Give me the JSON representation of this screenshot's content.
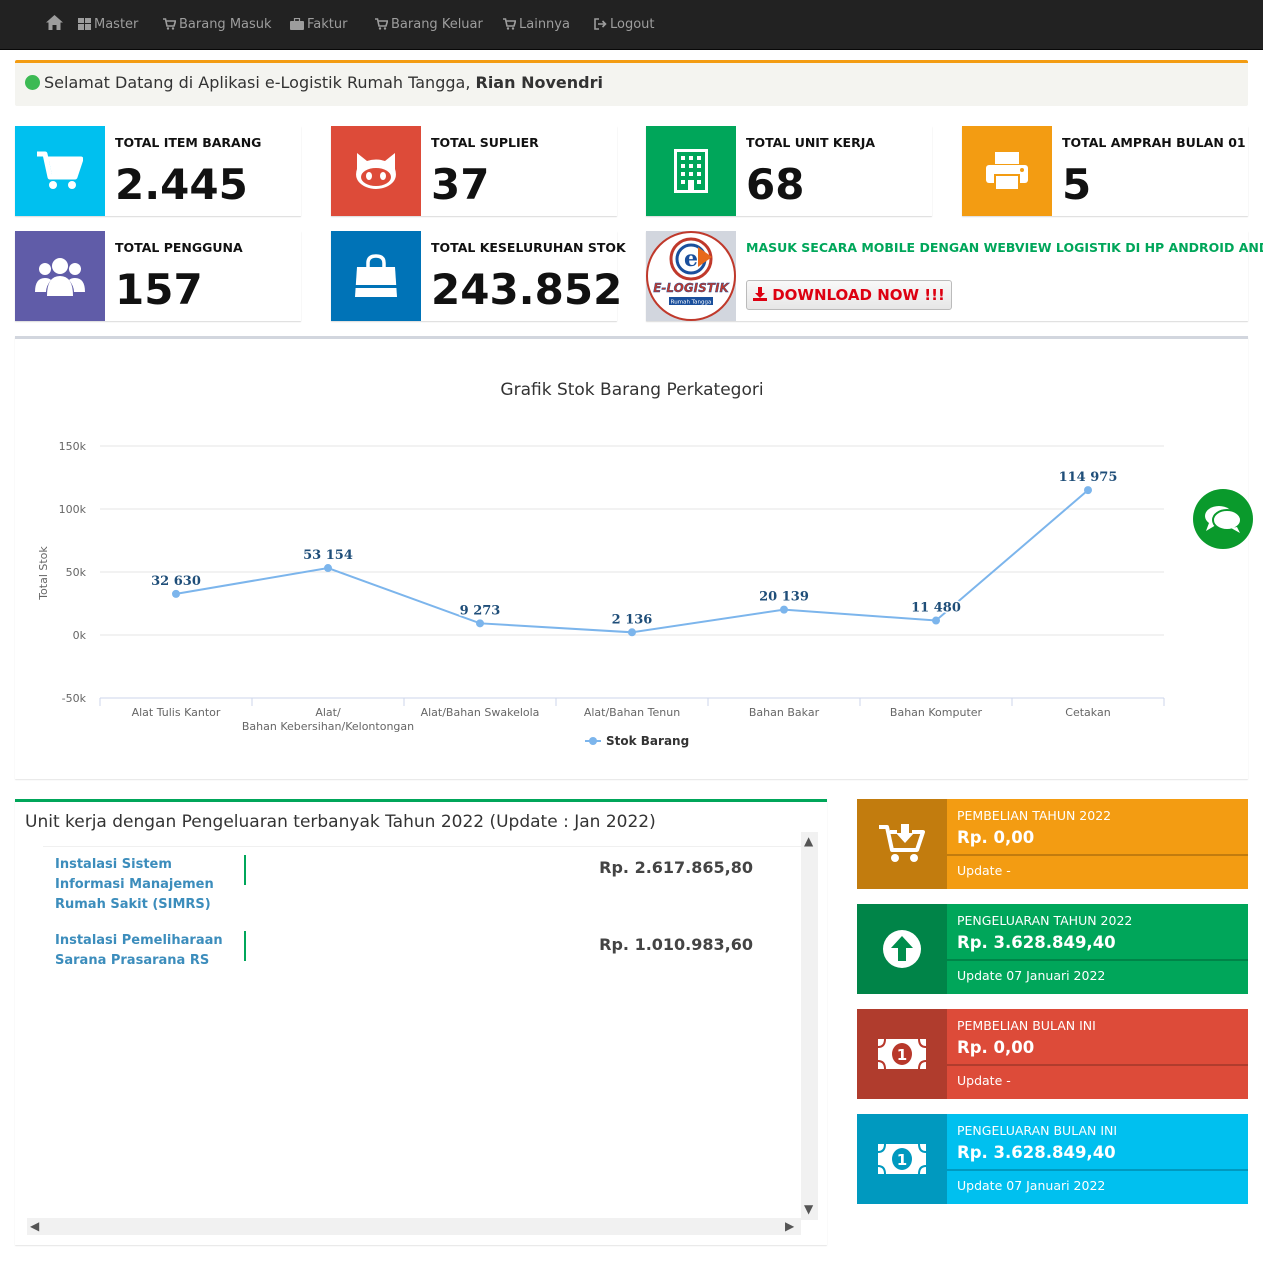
{
  "nav": {
    "home_icon": "home-icon",
    "items": [
      {
        "label": "Master",
        "icon": "th-large-icon"
      },
      {
        "label": "Barang Masuk",
        "icon": "cart-in-icon"
      },
      {
        "label": "Faktur",
        "icon": "briefcase-icon"
      },
      {
        "label": "Barang Keluar",
        "icon": "cart-out-icon"
      },
      {
        "label": "Lainnya",
        "icon": "cart-icon"
      },
      {
        "label": "Logout",
        "icon": "logout-icon"
      }
    ]
  },
  "welcome": {
    "text": "Selamat Datang di Aplikasi e-Logistik Rumah Tangga,",
    "user": "Rian Novendri"
  },
  "info_boxes": [
    {
      "label": "TOTAL ITEM BARANG",
      "value": "2.445",
      "color": "#00c0ef",
      "icon": "cart-icon"
    },
    {
      "label": "TOTAL SUPLIER",
      "value": "37",
      "color": "#dd4b39",
      "icon": "github-icon"
    },
    {
      "label": "TOTAL UNIT KERJA",
      "value": "68",
      "color": "#00a65a",
      "icon": "building-icon"
    },
    {
      "label": "TOTAL AMPRAH BULAN 01",
      "value": "5",
      "color": "#f39c12",
      "icon": "print-icon"
    },
    {
      "label": "TOTAL PENGGUNA",
      "value": "157",
      "color": "#605ca8",
      "icon": "users-icon"
    },
    {
      "label": "TOTAL KESELURUHAN STOK",
      "value": "243.852",
      "color": "#0073b7",
      "icon": "shopping-bag-icon"
    }
  ],
  "mobile": {
    "message": "MASUK SECARA MOBILE DENGAN WEBVIEW LOGISTIK DI HP ANDROID ANDA!",
    "button": "DOWNLOAD NOW !!!",
    "logo_text": "E-LOGISTIK",
    "logo_sub": "Rumah Tangga"
  },
  "chart_data": {
    "type": "line",
    "title": "Grafik Stok Barang Perkategori",
    "ylabel": "Total Stok",
    "xlabel": "",
    "categories": [
      "Alat Tulis Kantor",
      "Alat/Bahan Kebersihan/Kelontongan",
      "Alat/Bahan Swakelola",
      "Alat/Bahan Tenun",
      "Bahan Bakar",
      "Bahan Komputer",
      "Cetakan"
    ],
    "series": [
      {
        "name": "Stok Barang",
        "values": [
          32630,
          53154,
          9273,
          2136,
          20139,
          11480,
          114975
        ],
        "labels": [
          "32 630",
          "53 154",
          "9 273",
          "2 136",
          "20 139",
          "11 480",
          "114 975"
        ]
      }
    ],
    "ylim": [
      -50000,
      150000
    ],
    "yticks": [
      "-50k",
      "0k",
      "50k",
      "100k",
      "150k"
    ],
    "yticks_values": [
      -50000,
      0,
      50000,
      100000,
      150000
    ],
    "grid": true,
    "legend": "bottom-center",
    "color": "#7cb5ec"
  },
  "unit_kerja": {
    "title": "Unit kerja dengan Pengeluaran terbanyak Tahun 2022 (Update : Jan 2022)",
    "rows": [
      {
        "name": "Instalasi Sistem Informasi Manajemen Rumah Sakit (SIMRS)",
        "value": "Rp. 2.617.865,80"
      },
      {
        "name": "Instalasi Pemeliharaan Sarana Prasarana RS",
        "value": "Rp. 1.010.983,60"
      }
    ]
  },
  "stat_boxes": [
    {
      "title": "PEMBELIAN TAHUN 2022",
      "value": "Rp. 0,00",
      "update": "Update -",
      "color": "#f39c12",
      "icon": "cart-download-icon"
    },
    {
      "title": "PENGELUARAN TAHUN 2022",
      "value": "Rp. 3.628.849,40",
      "update": "Update 07 Januari 2022",
      "color": "#00a65a",
      "icon": "arrow-up-circle-icon"
    },
    {
      "title": "PEMBELIAN BULAN INI",
      "value": "Rp. 0,00",
      "update": "Update -",
      "color": "#dd4b39",
      "icon": "money-icon"
    },
    {
      "title": "PENGELUARAN BULAN INI",
      "value": "Rp. 3.628.849,40",
      "update": "Update 07 Januari 2022",
      "color": "#00c0ef",
      "icon": "money-icon"
    }
  ]
}
